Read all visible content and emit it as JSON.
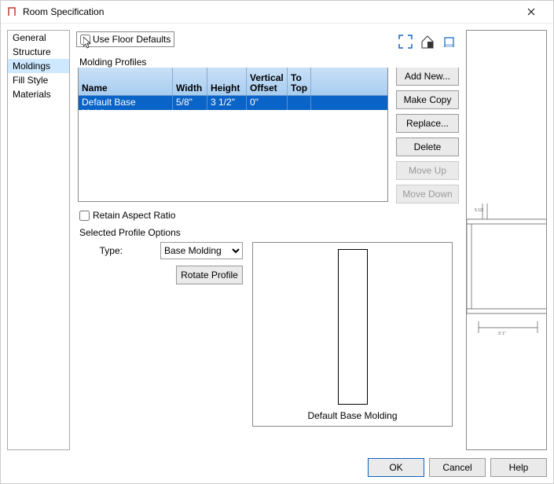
{
  "title": "Room Specification",
  "sidebar": {
    "items": [
      {
        "label": "General"
      },
      {
        "label": "Structure"
      },
      {
        "label": "Moldings"
      },
      {
        "label": "Fill Style"
      },
      {
        "label": "Materials"
      }
    ],
    "selected_index": 2
  },
  "main": {
    "use_floor_defaults_label": "Use Floor Defaults",
    "use_floor_defaults_checked": false,
    "molding_profiles_label": "Molding Profiles",
    "table": {
      "headers": {
        "name": "Name",
        "width": "Width",
        "height": "Height",
        "voff_line1": "Vertical",
        "voff_line2": "Offset",
        "totop_line1": "To",
        "totop_line2": "Top"
      },
      "rows": [
        {
          "name": "Default Base Molding",
          "width": "5/8\"",
          "height": "3 1/2\"",
          "voff": "0\"",
          "totop": ""
        }
      ]
    },
    "buttons": {
      "add_new": "Add New...",
      "make_copy": "Make Copy",
      "replace": "Replace...",
      "delete": "Delete",
      "move_up": "Move Up",
      "move_down": "Move Down"
    },
    "retain_aspect_label": "Retain Aspect Ratio",
    "retain_aspect_checked": false,
    "selected_profile_label": "Selected Profile Options",
    "type_label": "Type:",
    "type_value": "Base Molding",
    "rotate_label": "Rotate Profile",
    "preview_label": "Default Base Molding"
  },
  "bottom": {
    "ok": "OK",
    "cancel": "Cancel",
    "help": "Help"
  }
}
